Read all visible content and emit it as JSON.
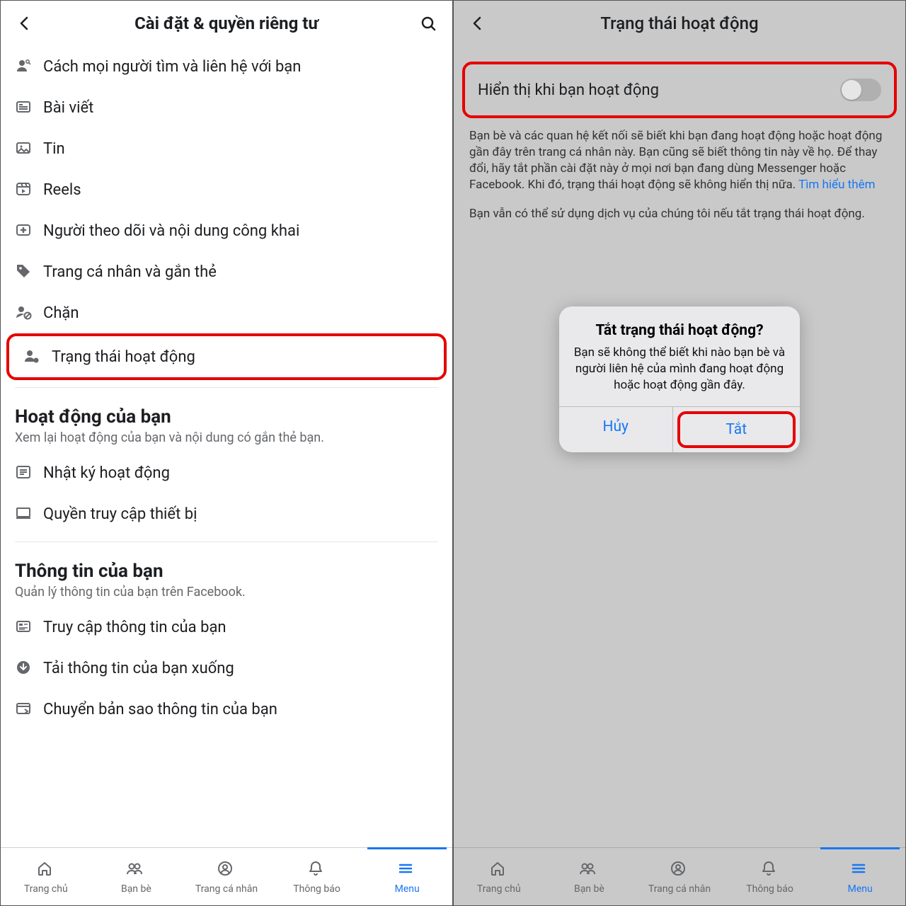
{
  "left": {
    "title": "Cài đặt & quyền riêng tư",
    "items": [
      {
        "icon": "people-find",
        "label": "Cách mọi người tìm và liên hệ với bạn"
      },
      {
        "icon": "post",
        "label": "Bài viết"
      },
      {
        "icon": "photo",
        "label": "Tin"
      },
      {
        "icon": "reels",
        "label": "Reels"
      },
      {
        "icon": "followers",
        "label": "Người theo dõi và nội dung công khai"
      },
      {
        "icon": "tag",
        "label": "Trang cá nhân và gắn thẻ"
      },
      {
        "icon": "block",
        "label": "Chặn"
      },
      {
        "icon": "status",
        "label": "Trạng thái hoạt động"
      }
    ],
    "sections": [
      {
        "title": "Hoạt động của bạn",
        "sub": "Xem lại hoạt động của bạn và nội dung có gắn thẻ bạn.",
        "rows": [
          {
            "icon": "log",
            "label": "Nhật ký hoạt động"
          },
          {
            "icon": "device",
            "label": "Quyền truy cập thiết bị"
          }
        ]
      },
      {
        "title": "Thông tin của bạn",
        "sub": "Quản lý thông tin của bạn trên Facebook.",
        "rows": [
          {
            "icon": "info",
            "label": "Truy cập thông tin của bạn"
          },
          {
            "icon": "download",
            "label": "Tải thông tin của bạn xuống"
          },
          {
            "icon": "transfer",
            "label": "Chuyển bản sao thông tin của bạn"
          }
        ]
      }
    ]
  },
  "right": {
    "title": "Trạng thái hoạt động",
    "toggle_label": "Hiển thị khi bạn hoạt động",
    "desc": "Bạn bè và các quan hệ kết nối sẽ biết khi bạn đang hoạt động hoặc hoạt động gần đây trên trang cá nhân này. Bạn cũng sẽ biết thông tin này về họ. Để thay đổi, hãy tắt phần cài đặt này ở mọi nơi bạn đang dùng Messenger hoặc Facebook. Khi đó, trạng thái hoạt động sẽ không hiển thị nữa. ",
    "desc_link": "Tìm hiểu thêm",
    "desc2": "Bạn vẫn có thể sử dụng dịch vụ của chúng tôi nếu tắt trạng thái hoạt động.",
    "dialog": {
      "title": "Tắt trạng thái hoạt động?",
      "msg": "Bạn sẽ không thể biết khi nào bạn bè và người liên hệ của mình đang hoạt động hoặc hoạt động gần đây.",
      "cancel": "Hủy",
      "confirm": "Tắt"
    }
  },
  "nav": [
    {
      "icon": "home",
      "label": "Trang chủ"
    },
    {
      "icon": "friends",
      "label": "Bạn bè"
    },
    {
      "icon": "profile",
      "label": "Trang cá nhân"
    },
    {
      "icon": "bell",
      "label": "Thông báo"
    },
    {
      "icon": "menu",
      "label": "Menu"
    }
  ]
}
